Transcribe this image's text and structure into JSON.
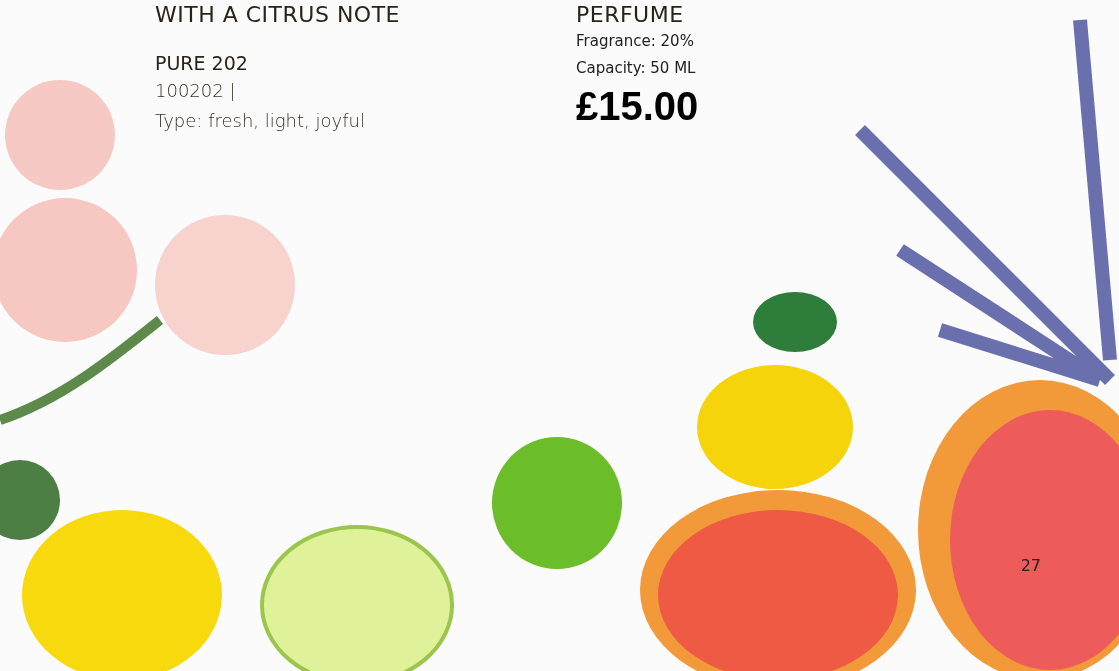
{
  "left": {
    "heading": "WITH A CITRUS NOTE",
    "name": "PURE 202",
    "code": "100202 |",
    "type": "Type: fresh, light, joyful"
  },
  "right": {
    "heading": "PERFUME",
    "details": [
      "Fragrance: 20%",
      "Capacity: 50 ML"
    ],
    "price": "£15.00"
  },
  "page_number": "27"
}
